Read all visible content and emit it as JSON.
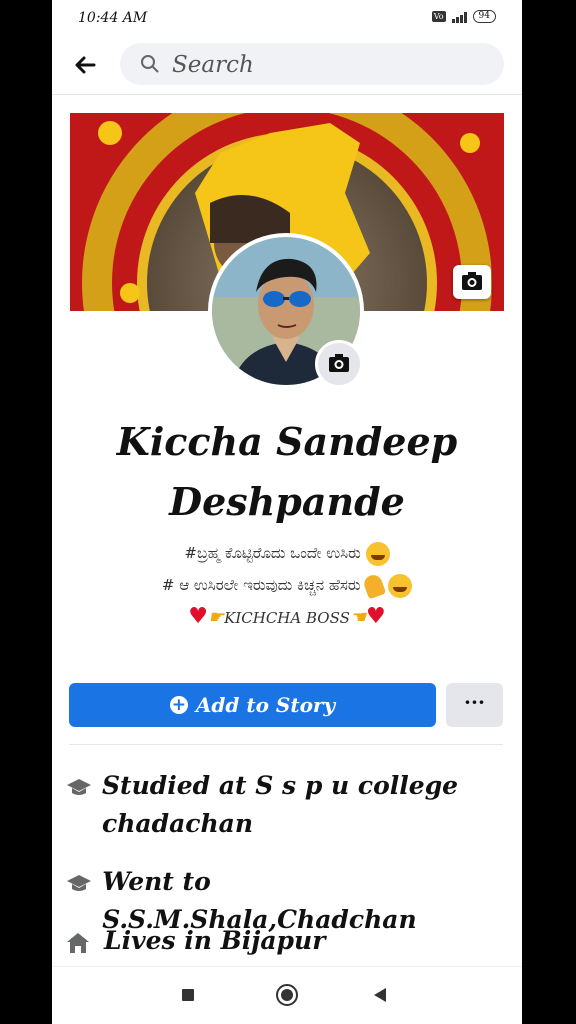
{
  "status_bar": {
    "time": "10:44 AM",
    "volte": "Vo LTE",
    "network": "4G",
    "battery": "94"
  },
  "header": {
    "search_placeholder": "Search"
  },
  "profile": {
    "name_line1": "Kiccha Sandeep",
    "name_line2": "Deshpande",
    "bio_line1": "#ಬ್ರಹ್ಮ ಕೊಟ್ಟಿರೊದು ಒಂದೇ ಉಸಿರು",
    "bio_line2": "# ಆ ಉಸಿರಲೇ ಇರುವುದು ಕಿಚ್ಚನ ಹೆಸರು",
    "bio_line3": "KICHCHA BOSS"
  },
  "actions": {
    "add_story_label": "Add to Story",
    "more_label": "···"
  },
  "details": [
    {
      "icon": "graduation-cap-icon",
      "text": "Studied at S s p u college chadachan"
    },
    {
      "icon": "graduation-cap-icon",
      "text": "Went to S.S.M.Shala,Chadchan"
    },
    {
      "icon": "home-icon",
      "text": "Lives in Bijapur"
    }
  ],
  "colors": {
    "accent": "#1b74e4",
    "secondary_button": "#e4e6eb",
    "heart": "#e0102a"
  }
}
